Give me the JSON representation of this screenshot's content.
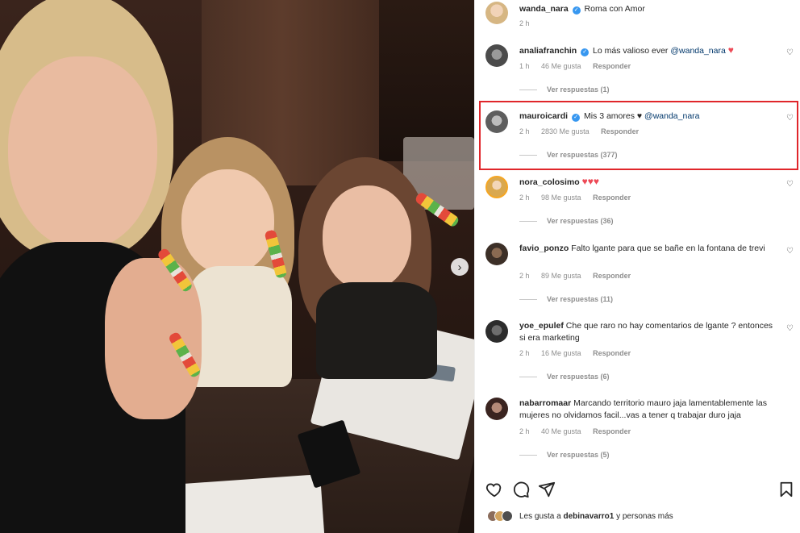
{
  "post": {
    "author": "wanda_nara",
    "caption": "Roma con Amor",
    "time": "2 h"
  },
  "comments": [
    {
      "user": "analiafranchin",
      "verified": true,
      "text": "Lo más valioso ever",
      "mention": "@wanda_nara",
      "suffix": "♥",
      "time": "1 h",
      "likes": "46 Me gusta",
      "reply": "Responder",
      "replies": "Ver respuestas (1)"
    },
    {
      "user": "mauroicardi",
      "verified": true,
      "text": "Mis 3 amores ♥",
      "mention": "@wanda_nara",
      "time": "2 h",
      "likes": "2830 Me gusta",
      "reply": "Responder",
      "replies": "Ver respuestas (377)"
    },
    {
      "user": "nora_colosimo",
      "verified": false,
      "text": "♥♥♥",
      "time": "2 h",
      "likes": "98 Me gusta",
      "reply": "Responder",
      "replies": "Ver respuestas (36)"
    },
    {
      "user": "favio_ponzo",
      "verified": false,
      "text": "Falto lgante para que se bañe en la fontana de trevi",
      "time": "2 h",
      "likes": "89 Me gusta",
      "reply": "Responder",
      "replies": "Ver respuestas (11)"
    },
    {
      "user": "yoe_epulef",
      "verified": false,
      "text": "Che que raro no hay comentarios de lgante ? entonces si era marketing",
      "time": "2 h",
      "likes": "16 Me gusta",
      "reply": "Responder",
      "replies": "Ver respuestas (6)"
    },
    {
      "user": "nabarromaar",
      "verified": false,
      "text": "Marcando territorio mauro jaja lamentablemente las mujeres no olvidamos facil...vas a tener q trabajar duro jaja",
      "time": "2 h",
      "likes": "40 Me gusta",
      "reply": "Responder",
      "replies": "Ver respuestas (5)"
    }
  ],
  "likes_summary": {
    "prefix": "Les gusta a",
    "user": "debinavarro1",
    "suffix": "y personas más"
  },
  "icons": {
    "like": "heart-outline-icon",
    "comment": "comment-bubble-icon",
    "share": "paper-plane-icon",
    "save": "bookmark-icon",
    "next": "chevron-right-icon"
  },
  "colors": {
    "highlight_border": "#e0262b",
    "verified": "#3797f0",
    "heart": "#ed4956",
    "meta_text": "#8e8e8e",
    "mention": "#00376b"
  }
}
